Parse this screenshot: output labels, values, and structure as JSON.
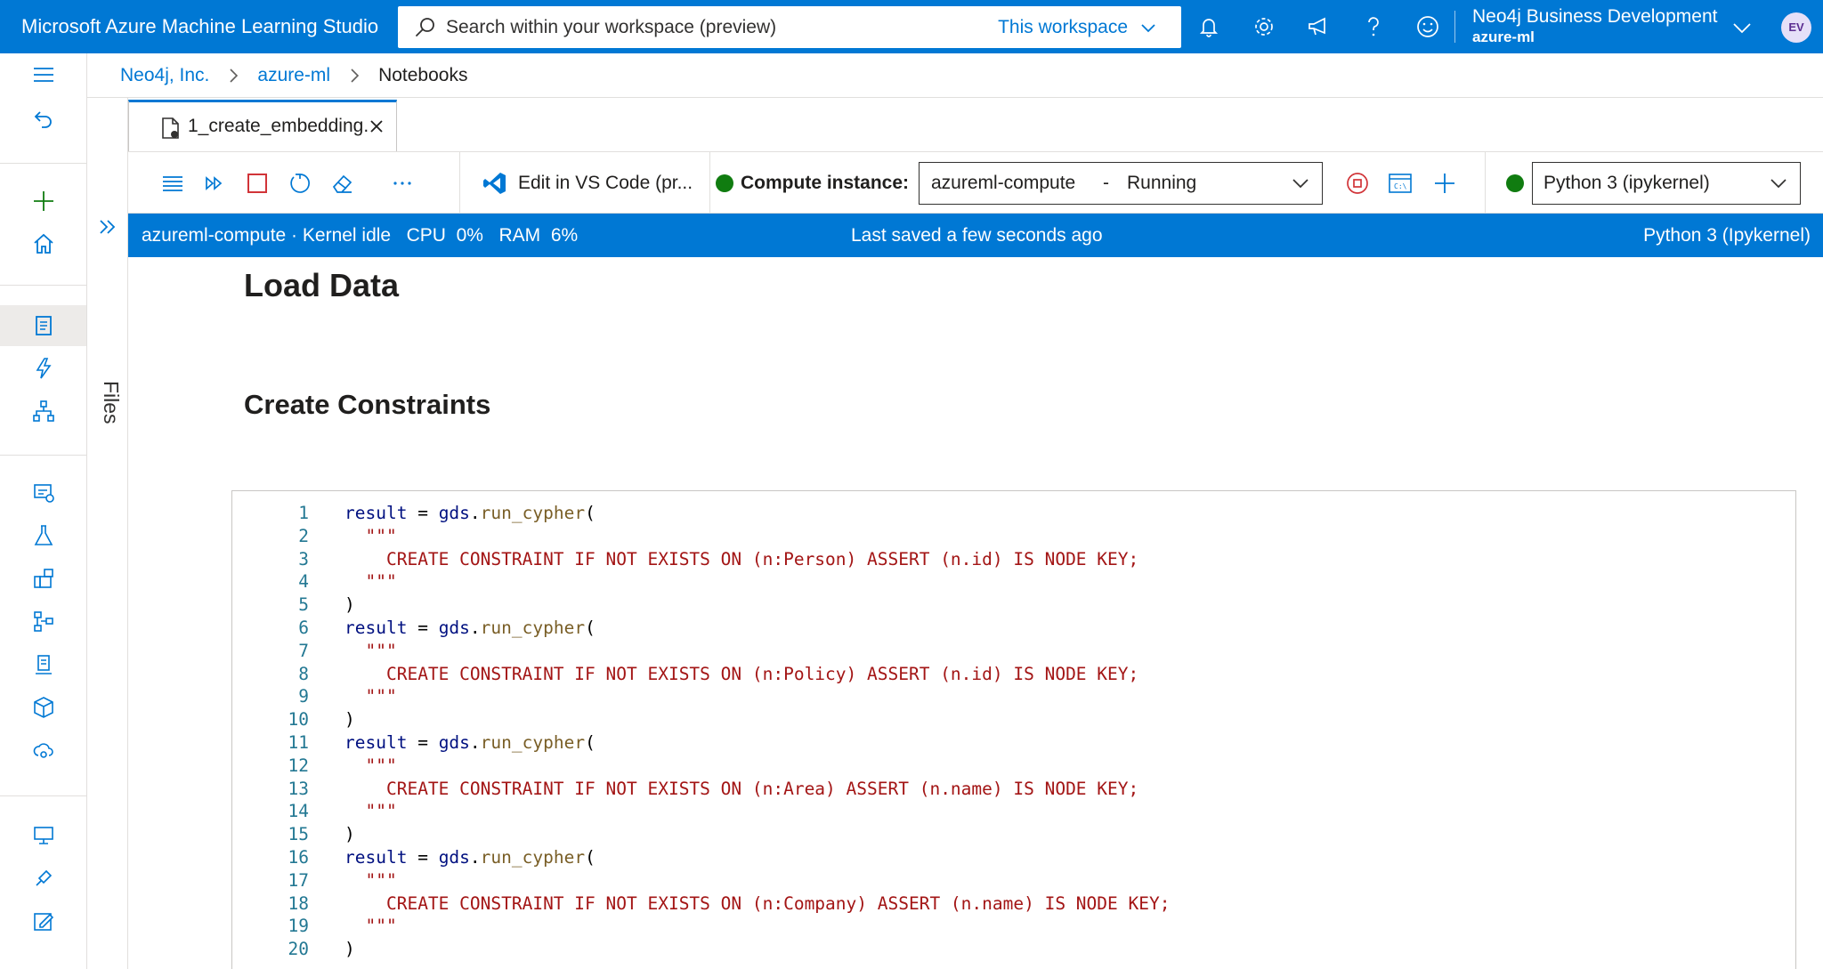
{
  "topbar": {
    "app_title": "Microsoft Azure Machine Learning Studio",
    "search_placeholder": "Search within your workspace (preview)",
    "scope_label": "This workspace",
    "account_name": "Neo4j Business Development",
    "workspace": "azure-ml",
    "avatar_initials": "EV"
  },
  "breadcrumb": {
    "items": [
      "Neo4j, Inc.",
      "azure-ml"
    ],
    "current": "Notebooks"
  },
  "files_pane": {
    "label": "Files"
  },
  "tab": {
    "label": "1_create_embedding."
  },
  "toolbar": {
    "vscode_label": "Edit in VS Code (pr...",
    "compute_label": "Compute instance:",
    "compute_name": "azureml-compute",
    "compute_sep": "-",
    "compute_state": "Running",
    "kernel_name": "Python 3 (ipykernel)"
  },
  "statusbar": {
    "left": "azureml-compute · Kernel idle   CPU  0%   RAM  6%",
    "center": "Last saved a few seconds ago",
    "right": "Python 3 (Ipykernel)"
  },
  "notebook": {
    "heading1": "Load Data",
    "heading2": "Create Constraints",
    "code_lines": [
      {
        "n": "1",
        "indent": "",
        "text": "result = gds.run_cypher(",
        "kind": "call"
      },
      {
        "n": "2",
        "indent": "  ",
        "text": "\"\"\"",
        "kind": "str"
      },
      {
        "n": "3",
        "indent": "    ",
        "text": "CREATE CONSTRAINT IF NOT EXISTS ON (n:Person) ASSERT (n.id) IS NODE KEY;",
        "kind": "str"
      },
      {
        "n": "4",
        "indent": "  ",
        "text": "\"\"\"",
        "kind": "str"
      },
      {
        "n": "5",
        "indent": "",
        "text": ")",
        "kind": "punc"
      },
      {
        "n": "6",
        "indent": "",
        "text": "result = gds.run_cypher(",
        "kind": "call"
      },
      {
        "n": "7",
        "indent": "  ",
        "text": "\"\"\"",
        "kind": "str"
      },
      {
        "n": "8",
        "indent": "    ",
        "text": "CREATE CONSTRAINT IF NOT EXISTS ON (n:Policy) ASSERT (n.id) IS NODE KEY;",
        "kind": "str"
      },
      {
        "n": "9",
        "indent": "  ",
        "text": "\"\"\"",
        "kind": "str"
      },
      {
        "n": "10",
        "indent": "",
        "text": ")",
        "kind": "punc"
      },
      {
        "n": "11",
        "indent": "",
        "text": "result = gds.run_cypher(",
        "kind": "call"
      },
      {
        "n": "12",
        "indent": "  ",
        "text": "\"\"\"",
        "kind": "str"
      },
      {
        "n": "13",
        "indent": "    ",
        "text": "CREATE CONSTRAINT IF NOT EXISTS ON (n:Area) ASSERT (n.name) IS NODE KEY;",
        "kind": "str"
      },
      {
        "n": "14",
        "indent": "  ",
        "text": "\"\"\"",
        "kind": "str"
      },
      {
        "n": "15",
        "indent": "",
        "text": ")",
        "kind": "punc"
      },
      {
        "n": "16",
        "indent": "",
        "text": "result = gds.run_cypher(",
        "kind": "call"
      },
      {
        "n": "17",
        "indent": "  ",
        "text": "\"\"\"",
        "kind": "str"
      },
      {
        "n": "18",
        "indent": "    ",
        "text": "CREATE CONSTRAINT IF NOT EXISTS ON (n:Company) ASSERT (n.name) IS NODE KEY;",
        "kind": "str"
      },
      {
        "n": "19",
        "indent": "  ",
        "text": "\"\"\"",
        "kind": "str"
      },
      {
        "n": "20",
        "indent": "",
        "text": ")",
        "kind": "punc"
      }
    ]
  },
  "colors": {
    "accent": "#0078d4",
    "running": "#107c10",
    "stop": "#d13438",
    "string": "#a31515",
    "line_number": "#237893"
  }
}
